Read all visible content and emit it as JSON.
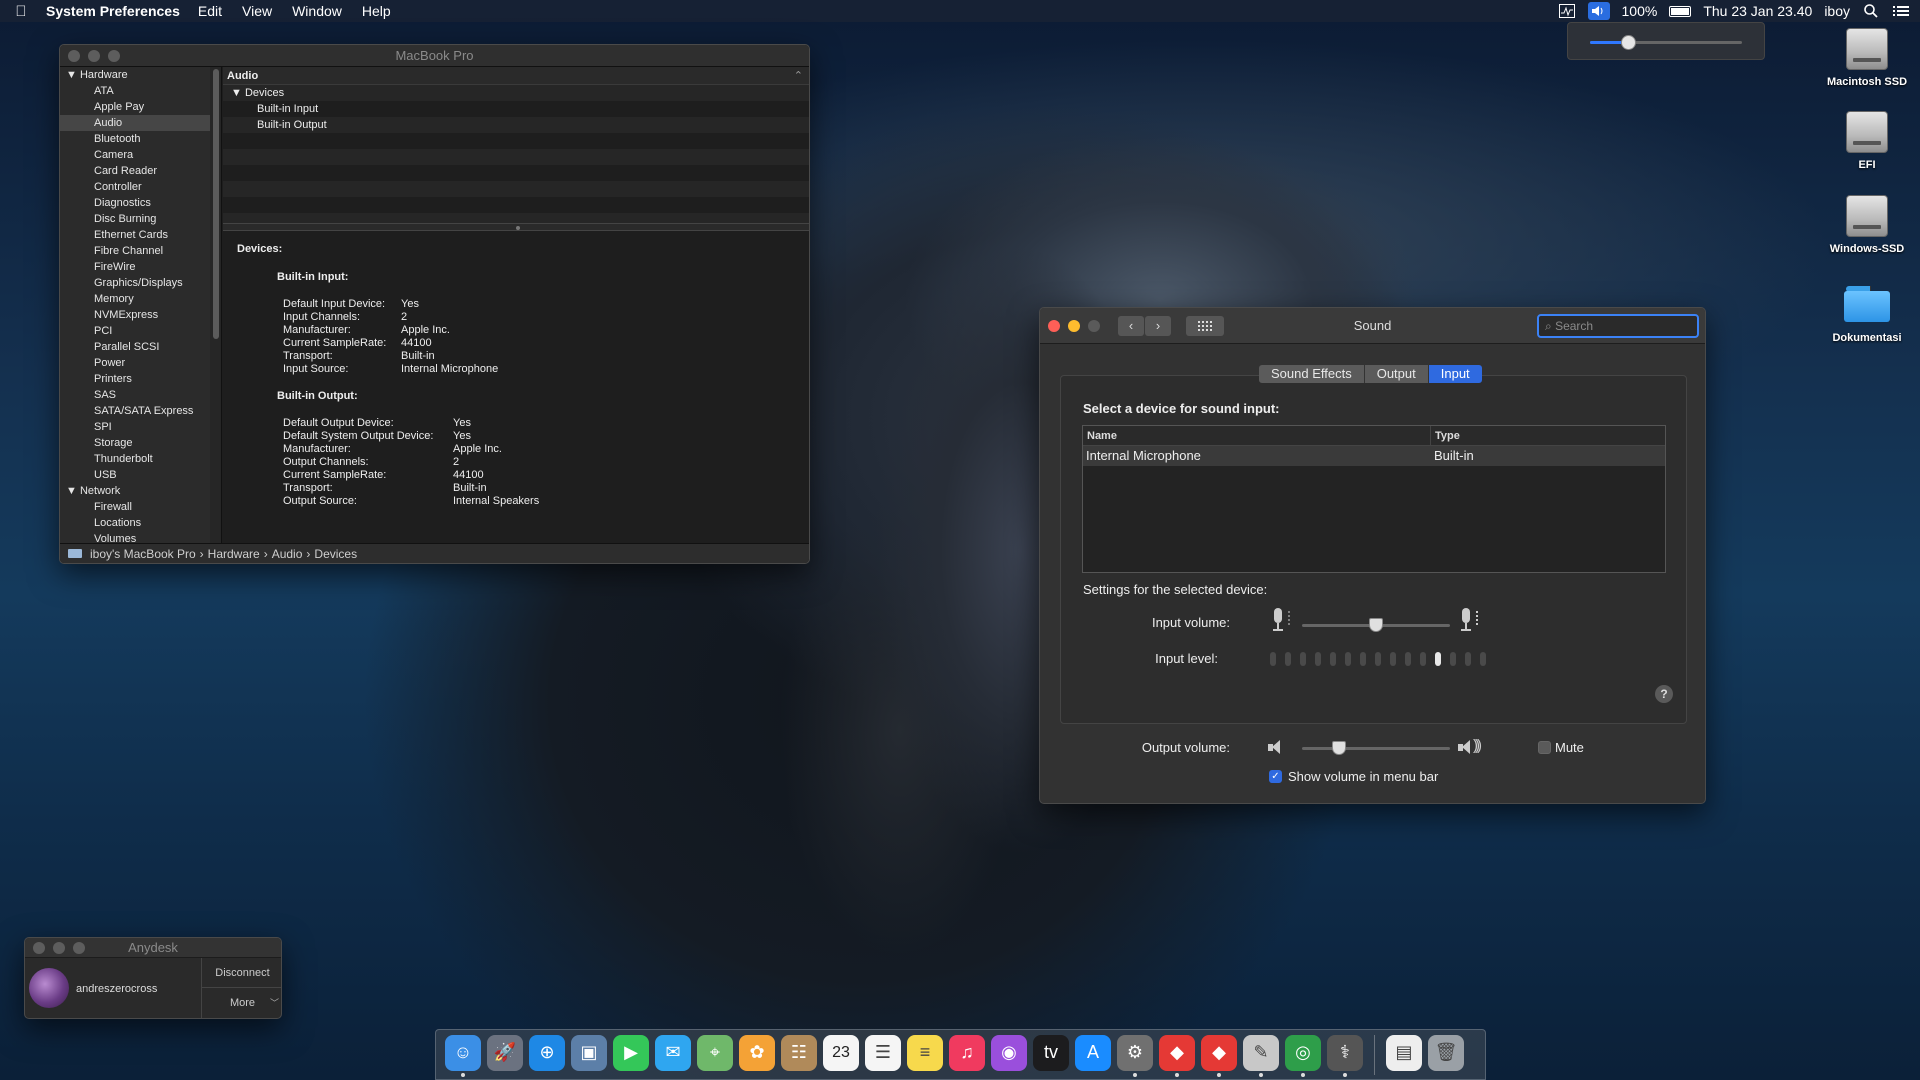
{
  "menubar": {
    "app_name": "System Preferences",
    "menus": [
      "Edit",
      "View",
      "Window",
      "Help"
    ],
    "battery": "100%",
    "datetime": "Thu 23 Jan  23.40",
    "user": "iboy",
    "icons": [
      "apple-icon",
      "activity-icon",
      "volume-icon",
      "battery-icon",
      "spotlight-icon",
      "notification-center-icon"
    ]
  },
  "volume_popup": {
    "level": 0.25,
    "accent": "#2f78ff"
  },
  "desktop_icons": [
    {
      "label": "Macintosh SSD",
      "icon": "drive-icon"
    },
    {
      "label": "EFI",
      "icon": "drive-icon"
    },
    {
      "label": "Windows-SSD",
      "icon": "drive-icon"
    },
    {
      "label": "Dokumentasi",
      "icon": "folder-icon"
    }
  ],
  "sysinfo": {
    "title": "MacBook Pro",
    "sidebar": {
      "hardware_group": "Hardware",
      "hardware_items": [
        "ATA",
        "Apple Pay",
        "Audio",
        "Bluetooth",
        "Camera",
        "Card Reader",
        "Controller",
        "Diagnostics",
        "Disc Burning",
        "Ethernet Cards",
        "Fibre Channel",
        "FireWire",
        "Graphics/Displays",
        "Memory",
        "NVMExpress",
        "PCI",
        "Parallel SCSI",
        "Power",
        "Printers",
        "SAS",
        "SATA/SATA Express",
        "SPI",
        "Storage",
        "Thunderbolt",
        "USB"
      ],
      "selected": "Audio",
      "network_group": "Network",
      "network_items": [
        "Firewall",
        "Locations",
        "Volumes"
      ]
    },
    "tree": {
      "header": "Audio",
      "collapse_glyph": "⌃",
      "devices_label": "Devices",
      "children": [
        "Built-in Input",
        "Built-in Output"
      ]
    },
    "detail": {
      "heading": "Devices:",
      "input_title": "Built-in Input:",
      "input_rows": [
        [
          "Default Input Device:",
          "Yes"
        ],
        [
          "Input Channels:",
          "2"
        ],
        [
          "Manufacturer:",
          "Apple Inc."
        ],
        [
          "Current SampleRate:",
          "44100"
        ],
        [
          "Transport:",
          "Built-in"
        ],
        [
          "Input Source:",
          "Internal Microphone"
        ]
      ],
      "output_title": "Built-in Output:",
      "output_rows": [
        [
          "Default Output Device:",
          "Yes"
        ],
        [
          "Default System Output Device:",
          "Yes"
        ],
        [
          "Manufacturer:",
          "Apple Inc."
        ],
        [
          "Output Channels:",
          "2"
        ],
        [
          "Current SampleRate:",
          "44100"
        ],
        [
          "Transport:",
          "Built-in"
        ],
        [
          "Output Source:",
          "Internal Speakers"
        ]
      ]
    },
    "path": [
      "iboy's MacBook Pro",
      "Hardware",
      "Audio",
      "Devices"
    ],
    "path_sep": "›"
  },
  "sound": {
    "title": "Sound",
    "search_placeholder": "Search",
    "tabs": [
      "Sound Effects",
      "Output",
      "Input"
    ],
    "active_tab": "Input",
    "select_label": "Select a device for sound input:",
    "table": {
      "columns": [
        "Name",
        "Type"
      ],
      "rows": [
        [
          "Internal Microphone",
          "Built-in"
        ]
      ]
    },
    "settings_label": "Settings for the selected device:",
    "input_volume_label": "Input volume:",
    "input_volume": 0.5,
    "input_level_label": "Input level:",
    "input_level_active_bar": 12,
    "input_level_bars": 15,
    "help": "?",
    "output_volume_label": "Output volume:",
    "output_volume": 0.25,
    "mute_label": "Mute",
    "mute_checked": false,
    "show_volume_label": "Show volume in menu bar",
    "show_volume_checked": true,
    "accent": "#2f6ae0"
  },
  "anydesk": {
    "title": "Anydesk",
    "user": "andreszerocross",
    "disconnect": "Disconnect",
    "more": "More"
  },
  "dock": {
    "apps": [
      {
        "name": "finder-icon",
        "color": "#3b8fe6",
        "running": true
      },
      {
        "name": "launchpad-icon",
        "color": "#6b7280",
        "running": false
      },
      {
        "name": "safari-icon",
        "color": "#1e88e5",
        "running": false
      },
      {
        "name": "preview-icon",
        "color": "#5c7fa8",
        "running": false
      },
      {
        "name": "facetime-icon",
        "color": "#34c759",
        "running": false
      },
      {
        "name": "messages-icon",
        "color": "#2fa6f0",
        "running": false
      },
      {
        "name": "maps-icon",
        "color": "#6fb86a",
        "running": false
      },
      {
        "name": "photos-icon",
        "color": "#f4a236",
        "running": false
      },
      {
        "name": "contacts-icon",
        "color": "#b08a5a",
        "running": false
      },
      {
        "name": "calendar-icon",
        "color": "#f5f5f5",
        "running": false
      },
      {
        "name": "reminders-icon",
        "color": "#f5f5f5",
        "running": false
      },
      {
        "name": "notes-icon",
        "color": "#f7d94c",
        "running": false
      },
      {
        "name": "music-icon",
        "color": "#f03a5f",
        "running": false
      },
      {
        "name": "podcasts-icon",
        "color": "#9a4fdc",
        "running": false
      },
      {
        "name": "apple-tv-icon",
        "color": "#1c1c1e",
        "running": false
      },
      {
        "name": "app-store-icon",
        "color": "#1a8cff",
        "running": false
      },
      {
        "name": "system-preferences-icon",
        "color": "#707070",
        "running": true
      },
      {
        "name": "anydesk-icon",
        "color": "#e53935",
        "running": true
      },
      {
        "name": "anydesk-alt-icon",
        "color": "#e53935",
        "running": true
      },
      {
        "name": "script-editor-icon",
        "color": "#c8c8c8",
        "running": true
      },
      {
        "name": "network-utility-icon",
        "color": "#2e9e4a",
        "running": true
      },
      {
        "name": "system-information-icon",
        "color": "#555",
        "running": true
      }
    ],
    "trailing": [
      {
        "name": "document-icon",
        "color": "#eeeeee"
      },
      {
        "name": "trash-icon",
        "color": "#9aa0a6"
      }
    ],
    "calendar_day": "23"
  }
}
